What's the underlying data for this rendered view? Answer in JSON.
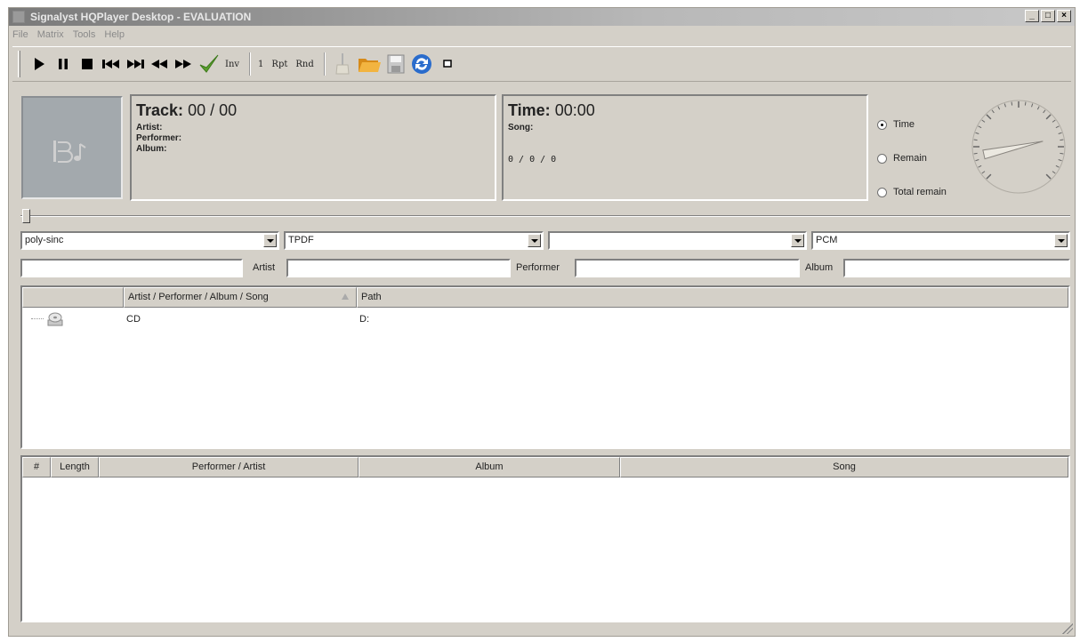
{
  "window": {
    "title": "Signalyst HQPlayer Desktop - EVALUATION",
    "controls": [
      "_",
      "□",
      "×"
    ]
  },
  "menu": [
    "File",
    "Matrix",
    "Tools",
    "Help"
  ],
  "toolbar": {
    "buttons": [
      {
        "name": "play",
        "icon": "play-icon"
      },
      {
        "name": "pause",
        "icon": "pause-icon"
      },
      {
        "name": "stop",
        "icon": "stop-icon"
      },
      {
        "name": "previous",
        "icon": "skip-back-icon"
      },
      {
        "name": "next",
        "icon": "skip-forward-icon"
      },
      {
        "name": "rewind",
        "icon": "rewind-icon"
      },
      {
        "name": "fast-forward",
        "icon": "fast-forward-icon"
      },
      {
        "name": "apply",
        "icon": "checkmark-icon"
      }
    ],
    "inv_label": "Inv",
    "one_label": "1",
    "rpt_label": "Rpt",
    "rnd_label": "Rnd",
    "file_icons": [
      "clear-icon",
      "open-folder-icon",
      "save-icon",
      "refresh-icon",
      "window-icon"
    ]
  },
  "now_playing": {
    "track_label": "Track:",
    "track_value": "00 / 00",
    "artist_label": "Artist:",
    "performer_label": "Performer:",
    "album_label": "Album:",
    "time_label": "Time:",
    "time_value": "00:00",
    "song_label": "Song:",
    "counter": "0 / 0 / 0"
  },
  "time_mode": {
    "options": [
      "Time",
      "Remain",
      "Total remain"
    ],
    "selected": "Time"
  },
  "dial": {
    "needle_value": 0.12
  },
  "seek": {
    "position": 0.0
  },
  "selectors": {
    "filter": "poly-sinc",
    "dither": "TPDF",
    "third": "",
    "mode": "PCM"
  },
  "search": {
    "main_value": "",
    "artist_label": "Artist",
    "artist_value": "",
    "performer_label": "Performer",
    "performer_value": "",
    "album_label": "Album",
    "album_value": ""
  },
  "library": {
    "columns": [
      "",
      "Artist / Performer / Album / Song",
      "Path"
    ],
    "rows": [
      {
        "name": "CD",
        "path": "D:"
      }
    ]
  },
  "playlist": {
    "columns": [
      "#",
      "Length",
      "Performer / Artist",
      "Album",
      "Song"
    ]
  },
  "colors": {
    "face": "#d4d0c8",
    "apply_green": "#5aa02c",
    "folder_orange": "#e8a22a",
    "refresh_blue": "#2a6ccc"
  }
}
